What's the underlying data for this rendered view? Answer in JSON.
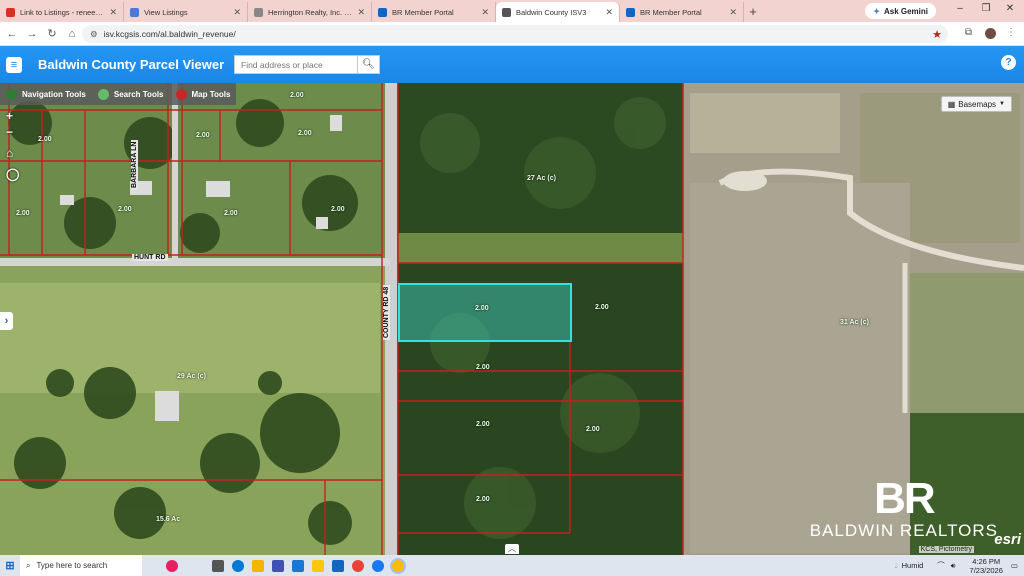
{
  "browser": {
    "tabs": [
      {
        "label": "Link to Listings - reneedonedr...",
        "icon": "gmail-icon",
        "color": "#d93025"
      },
      {
        "label": "View Listings",
        "icon": "view-icon",
        "color": "#4a7bd0"
      },
      {
        "label": "Herrington Realty, Inc. - Search",
        "icon": "page-icon",
        "color": "#888888"
      },
      {
        "label": "BR Member Portal",
        "icon": "br-icon",
        "color": "#1565c0"
      },
      {
        "label": "Baldwin County ISV3",
        "icon": "globe-icon",
        "color": "#555555",
        "active": true
      },
      {
        "label": "BR Member Portal",
        "icon": "br-icon",
        "color": "#1565c0"
      }
    ],
    "new_tab": "+",
    "gemini_label": "Ask Gemini",
    "url": "isv.kcgsis.com/al.baldwin_revenue/"
  },
  "app": {
    "title": "Baldwin County Parcel Viewer",
    "search_placeholder": "Find address or place",
    "help": "?"
  },
  "map": {
    "tools": [
      {
        "label": "Navigation Tools",
        "color": "#2e7d32"
      },
      {
        "label": "Search Tools",
        "color": "#66bb6a"
      },
      {
        "label": "Map Tools",
        "color": "#c62828"
      }
    ],
    "basemaps_label": "Basemaps",
    "roads": {
      "hunt_rd": "HUNT RD",
      "barbara_ln": "BARBARA LN",
      "county_rd": "COUNTY RD 48"
    },
    "parcel_labels": [
      "2.00",
      "2.00",
      "2.00",
      "2.00",
      "2.00",
      "2.00",
      "2.00",
      "2.00",
      "2.00",
      "2.00",
      "2.00",
      "2.00",
      "2.00",
      "2.00"
    ],
    "acre_labels": [
      "27 Ac (c)",
      "29 Ac (c)",
      "31 Ac (c)",
      "15.6 Ac"
    ],
    "watermark_title": "BALDWIN REALTORS",
    "watermark_logo": "BR",
    "esri": "esri",
    "attribution": "KCS, Pictometry"
  },
  "taskbar": {
    "search_placeholder": "Type here to search",
    "weather": "Humid",
    "time": "4:26 PM",
    "date": "7/23/2026"
  }
}
